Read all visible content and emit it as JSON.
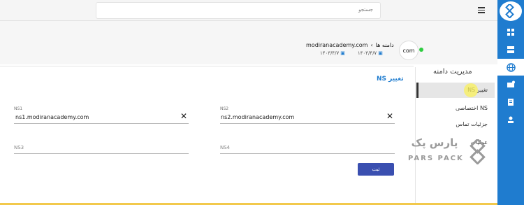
{
  "topbar": {
    "search_placeholder": "جستجو"
  },
  "header": {
    "domain_short": "com",
    "breadcrumb_parent": "دامنه ها",
    "breadcrumb_current": "modiranacademy.com",
    "date_registered": "۱۴۰۳/۴/۷",
    "date_expiry": "۱۴۰۳/۴/۷"
  },
  "sidenav": {
    "title": "مدیریت دامنه",
    "items": [
      {
        "label": "تغییر NS"
      },
      {
        "label": "NS اختصاصی"
      },
      {
        "label": "جزئیات تماس"
      },
      {
        "label": "عملیات"
      }
    ]
  },
  "form": {
    "title": "تغییر NS",
    "ns1_label": "NS1",
    "ns1_value": "ns1.modiranacademy.com",
    "ns2_label": "NS2",
    "ns2_value": "ns2.modiranacademy.com",
    "ns3_placeholder": "NS3",
    "ns4_placeholder": "NS4",
    "submit_label": "ثبت"
  },
  "watermark": {
    "fa": "پارس پک",
    "en": "PARS PACK"
  },
  "colors": {
    "accent": "#1f7ccf",
    "button": "#3a4fb0",
    "online": "#2ecc40"
  }
}
